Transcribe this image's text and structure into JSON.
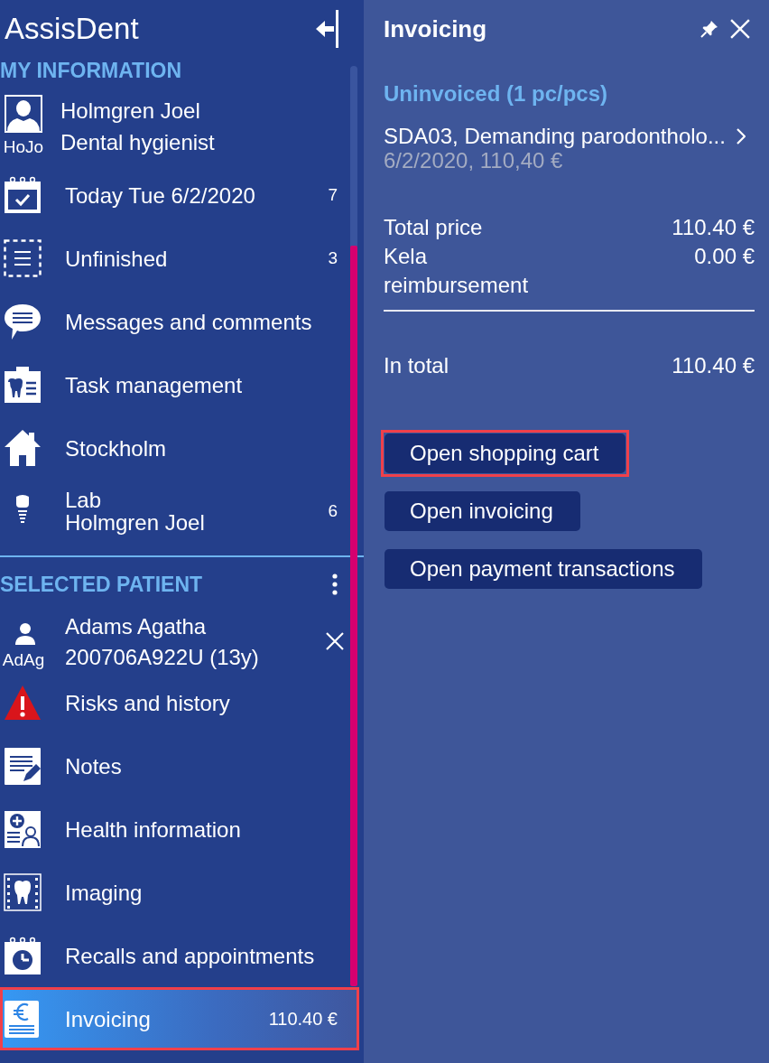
{
  "sidebar": {
    "title": "AssisDent",
    "my_information": {
      "heading": "MY INFORMATION",
      "user": {
        "initials": "HoJo",
        "name": "Holmgren Joel",
        "role": "Dental hygienist"
      },
      "items": [
        {
          "kind": "today",
          "label": "Today Tue 6/2/2020",
          "count": "7",
          "selected": false,
          "highlighted": false
        },
        {
          "kind": "unfinished",
          "label": "Unfinished",
          "count": "3",
          "selected": false,
          "highlighted": false
        },
        {
          "kind": "messages",
          "label": "Messages and comments",
          "selected": false,
          "highlighted": false
        },
        {
          "kind": "tasks",
          "label": "Task management",
          "selected": false,
          "highlighted": false
        },
        {
          "kind": "clinic",
          "label": "Stockholm",
          "selected": false,
          "highlighted": false
        },
        {
          "kind": "lab",
          "label": "Lab",
          "sublabel": "Holmgren Joel",
          "count": "6",
          "selected": false,
          "highlighted": false
        }
      ]
    },
    "selected_patient": {
      "heading": "SELECTED PATIENT",
      "patient": {
        "initials": "AdAg",
        "name": "Adams Agatha",
        "id": "200706A922U (13y)"
      },
      "items": [
        {
          "kind": "risks",
          "label": "Risks and history",
          "selected": false,
          "highlighted": false
        },
        {
          "kind": "notes",
          "label": "Notes",
          "selected": false,
          "highlighted": false
        },
        {
          "kind": "health",
          "label": "Health information",
          "selected": false,
          "highlighted": false
        },
        {
          "kind": "imaging",
          "label": "Imaging",
          "selected": false,
          "highlighted": false
        },
        {
          "kind": "recalls",
          "label": "Recalls and appointments",
          "selected": false,
          "highlighted": false
        },
        {
          "kind": "invoicing",
          "label": "Invoicing",
          "amount": "110.40 €",
          "selected": true,
          "highlighted": true
        }
      ]
    }
  },
  "panel": {
    "title": "Invoicing",
    "subheading": "Uninvoiced (1 pc/pcs)",
    "entries": [
      {
        "title": "SDA03, Demanding parodontholo...",
        "detail": "6/2/2020, 110,40 €"
      }
    ],
    "summary": [
      {
        "label": "Total price",
        "value": "110.40 €"
      },
      {
        "label": "Kela reimbursement",
        "value": "0.00 €"
      }
    ],
    "total": {
      "label": "In total",
      "value": "110.40 €"
    },
    "buttons": [
      {
        "label": "Open shopping cart",
        "highlighted": true
      },
      {
        "label": "Open invoicing",
        "highlighted": false
      },
      {
        "label": "Open payment transactions",
        "highlighted": false
      }
    ]
  }
}
